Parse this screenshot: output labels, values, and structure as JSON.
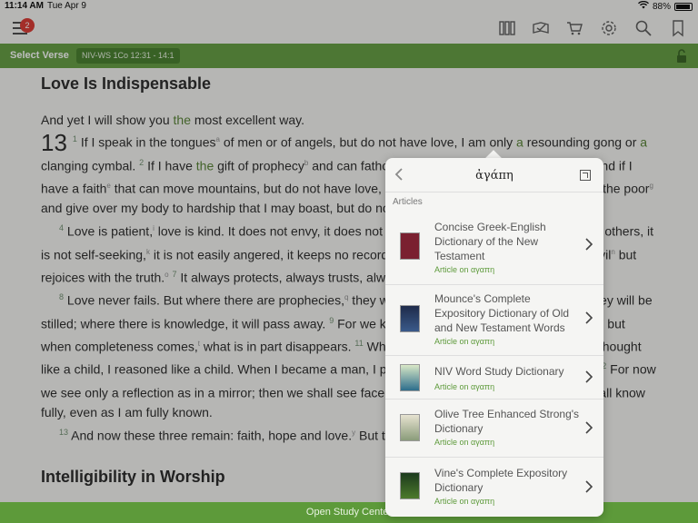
{
  "status": {
    "time": "11:14 AM",
    "date": "Tue Apr 9",
    "battery": "88%",
    "battery_level": 0.88
  },
  "toolbar": {
    "badge_count": "2"
  },
  "verse_bar": {
    "select_label": "Select Verse",
    "reference": "NIV-WS 1Co 12:31 - 14:1"
  },
  "reader": {
    "heading": "Love Is Indispensable",
    "chapter": "13",
    "section2": "Intelligibility in Worship"
  },
  "popover": {
    "title": "ἀγάπη",
    "section": "Articles",
    "items": [
      {
        "title": "Concise Greek-English Dictionary of the New Testament",
        "subtitle": "Article on αγαπη"
      },
      {
        "title": "Mounce's Complete Expository Dictionary of Old and New Testament Words",
        "subtitle": "Article on αγαπη"
      },
      {
        "title": "NIV Word Study Dictionary",
        "subtitle": "Article on αγαπη"
      },
      {
        "title": "Olive Tree Enhanced Strong's Dictionary",
        "subtitle": "Article on αγαπη"
      },
      {
        "title": "Vine's Complete Expository Dictionary",
        "subtitle": "Article on αγαπη"
      }
    ]
  },
  "bottom_bar": {
    "label": "Open Study Center"
  },
  "colors": {
    "accent_green": "#5d9a3a",
    "badge_red": "#d9322a"
  }
}
